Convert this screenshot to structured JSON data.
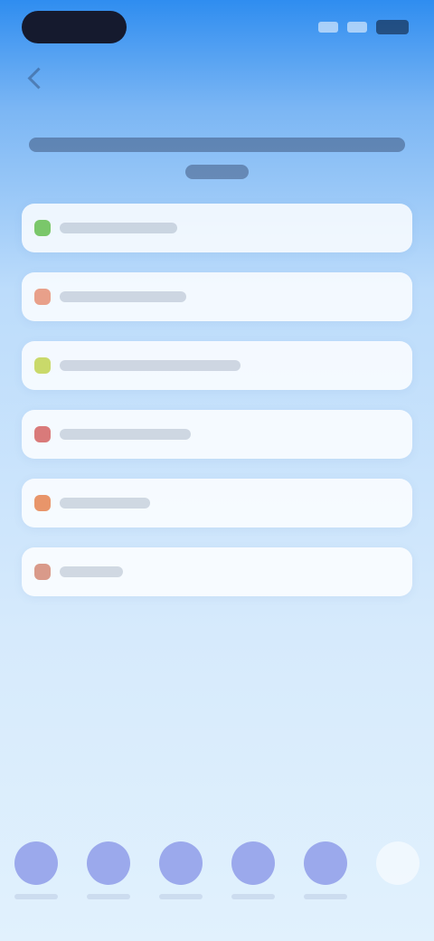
{
  "header": {
    "back_label": ""
  },
  "list": {
    "items": [
      {
        "label": "",
        "icon_color": "#7ac76a",
        "text_width": 130
      },
      {
        "label": "",
        "icon_color": "#e8a08a",
        "text_width": 140
      },
      {
        "label": "",
        "icon_color": "#c9d96a",
        "text_width": 200
      },
      {
        "label": "",
        "icon_color": "#d97a7a",
        "text_width": 145
      },
      {
        "label": "",
        "icon_color": "#e8956a",
        "text_width": 100
      },
      {
        "label": "",
        "icon_color": "#d99a8a",
        "text_width": 70
      }
    ]
  },
  "bottom_actions": [
    {
      "label": ""
    },
    {
      "label": ""
    },
    {
      "label": ""
    },
    {
      "label": ""
    },
    {
      "label": ""
    }
  ]
}
